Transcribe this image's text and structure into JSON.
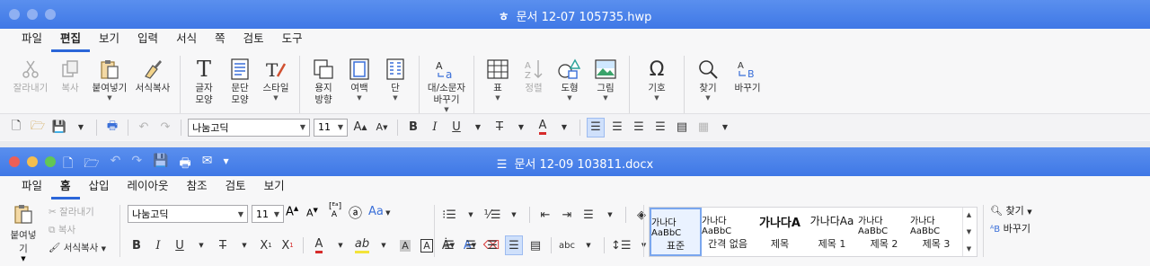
{
  "window1": {
    "title": "문서 12-07 105735.hwp",
    "title_icon": "ㅎ",
    "menu": [
      "파일",
      "편집",
      "보기",
      "입력",
      "서식",
      "쪽",
      "검토",
      "도구"
    ],
    "active_menu": "편집",
    "ribbon": {
      "cut": "잘라내기",
      "copy": "복사",
      "paste": "붙여넣기",
      "format_copy": "서식복사",
      "char_shape": "글자\n모양",
      "para_shape": "문단\n모양",
      "style": "스타일",
      "page_dir": "용지\n방향",
      "margin": "여백",
      "columns": "단",
      "case": "대/소문자\n바꾸기",
      "table": "표",
      "sort": "정렬",
      "shape": "도형",
      "picture": "그림",
      "symbol": "기호",
      "find": "찾기",
      "replace": "바꾸기"
    },
    "toolbar": {
      "font": "나눔고딕",
      "size": "11"
    }
  },
  "window2": {
    "title": "문서 12-09 103811.docx",
    "menu": [
      "파일",
      "홈",
      "삽입",
      "레이아웃",
      "참조",
      "검토",
      "보기"
    ],
    "active_menu": "홈",
    "clipboard": {
      "paste": "붙여넣기",
      "cut": "잘라내기",
      "copy": "복사",
      "format_copy": "서식복사"
    },
    "font": {
      "name": "나눔고딕",
      "size": "11"
    },
    "styles": [
      {
        "preview": "가나다AaBbC",
        "name": "표준"
      },
      {
        "preview": "가나다AaBbC",
        "name": "간격 없음"
      },
      {
        "preview": "가나다A",
        "name": "제목"
      },
      {
        "preview": "가나다Aa",
        "name": "제목 1"
      },
      {
        "preview": "가나다AaBbC",
        "name": "제목 2"
      },
      {
        "preview": "가나다AaBbC",
        "name": "제목 3"
      }
    ],
    "find": "찾기",
    "replace": "바꾸기"
  },
  "colors": {
    "titlebar": "#3f78e6",
    "accent": "#2b66d9",
    "font_color_bar": "#d62b2b",
    "highlight_bar": "#f3e33a",
    "close": "#ec5f57",
    "min": "#f4be4f",
    "max": "#62c655"
  }
}
